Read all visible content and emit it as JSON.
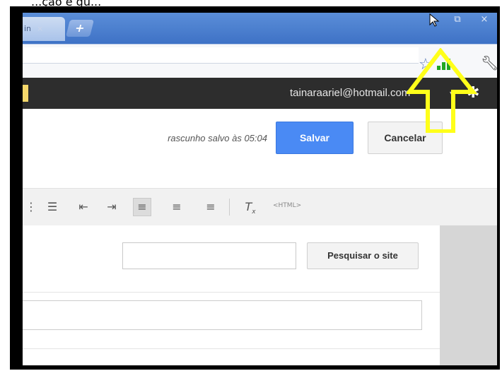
{
  "caption": "...ção e gu...",
  "browser": {
    "tab_text": "in",
    "tab_close": "×",
    "new_tab": "+",
    "window_buttons": [
      "◢",
      "⧉",
      "×"
    ]
  },
  "toolbar": {
    "star_icon": "star-icon",
    "signal_icon": "signal-icon",
    "wrench_icon": "wrench-icon"
  },
  "userbar": {
    "email": "tainaraariel@hotmail.com",
    "caret": "▾",
    "gear": "✱"
  },
  "editor": {
    "save_status": "rascunho salvo às 05:04",
    "save_label": "Salvar",
    "cancel_label": "Cancelar"
  },
  "format_toolbar": {
    "icons": [
      "bullet-list-icon",
      "numbered-list-icon",
      "indent-less-icon",
      "indent-more-icon",
      "align-left-icon",
      "align-center-icon",
      "align-right-icon",
      "clear-format-icon"
    ],
    "html_label": "<HTML>"
  },
  "content": {
    "search_button": "Pesquisar o site",
    "search_value": ""
  },
  "colors": {
    "annotation": "#ffff1a",
    "save_button": "#4a8af4",
    "userbar": "#2d2d2d"
  }
}
